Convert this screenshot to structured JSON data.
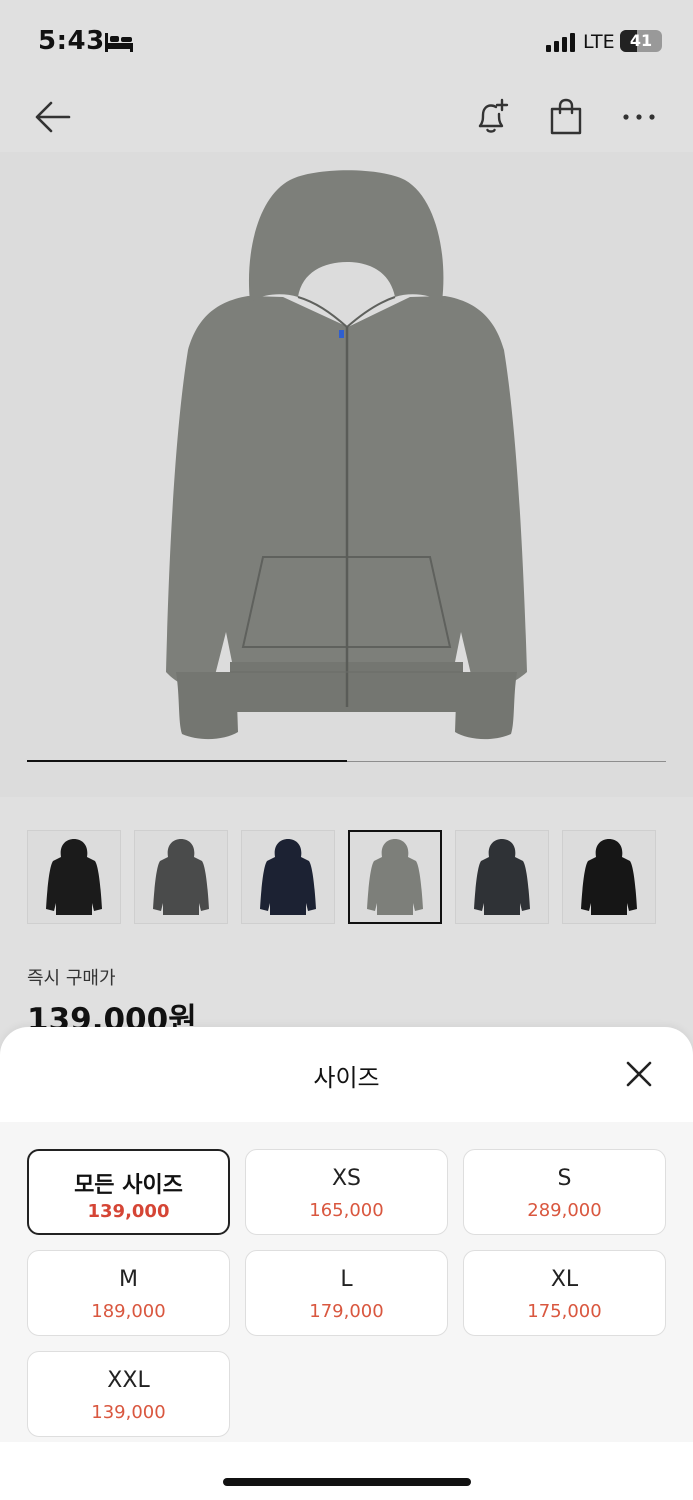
{
  "status_bar": {
    "time": "5:43",
    "network": "LTE",
    "battery_percent": "41",
    "battery_level": 0.41,
    "icons": [
      "sleep-focus-icon",
      "signal-icon",
      "battery-icon"
    ]
  },
  "nav": {
    "icons": [
      "back-arrow-icon",
      "bell-plus-icon",
      "shopping-bag-icon",
      "more-icon"
    ]
  },
  "product": {
    "hoodie_color": "#7d7f7a",
    "image_progress": 0.5,
    "thumbnails": [
      {
        "color": "#1b1b1b"
      },
      {
        "color": "#4a4b4b"
      },
      {
        "color": "#1c2233"
      },
      {
        "color": "#7d7f7a"
      },
      {
        "color": "#2f3236"
      },
      {
        "color": "#161616"
      }
    ],
    "selected_thumbnail_index": 3,
    "price_label": "즉시 구매가",
    "price": "139,000원"
  },
  "size_sheet": {
    "title": "사이즈",
    "options": [
      {
        "name": "모든 사이즈",
        "price": "139,000",
        "selected": true
      },
      {
        "name": "XS",
        "price": "165,000",
        "selected": false
      },
      {
        "name": "S",
        "price": "289,000",
        "selected": false
      },
      {
        "name": "M",
        "price": "189,000",
        "selected": false
      },
      {
        "name": "L",
        "price": "179,000",
        "selected": false
      },
      {
        "name": "XL",
        "price": "175,000",
        "selected": false
      },
      {
        "name": "XXL",
        "price": "139,000",
        "selected": false
      }
    ]
  },
  "colors": {
    "price_accent": "#d9573f",
    "background": "#e0e0e0"
  }
}
